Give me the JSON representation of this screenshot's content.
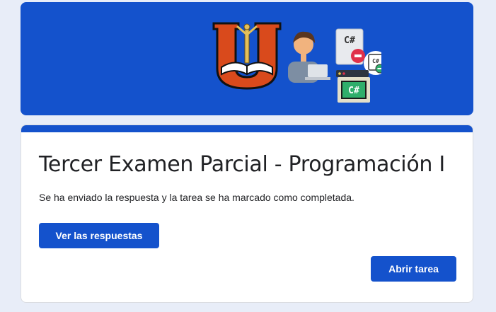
{
  "banner": {
    "logo_letter": "U",
    "badge_top": "C#",
    "badge_bottom": "C#",
    "badge_small": "C#"
  },
  "card": {
    "title": "Tercer Examen Parcial - Programación I",
    "message": "Se ha enviado la respuesta y la tarea se ha marcado como completada.",
    "view_responses_label": "Ver las respuestas",
    "open_task_label": "Abrir tarea"
  },
  "colors": {
    "primary": "#1452cc",
    "background": "#e8edf8",
    "text": "#202124"
  }
}
